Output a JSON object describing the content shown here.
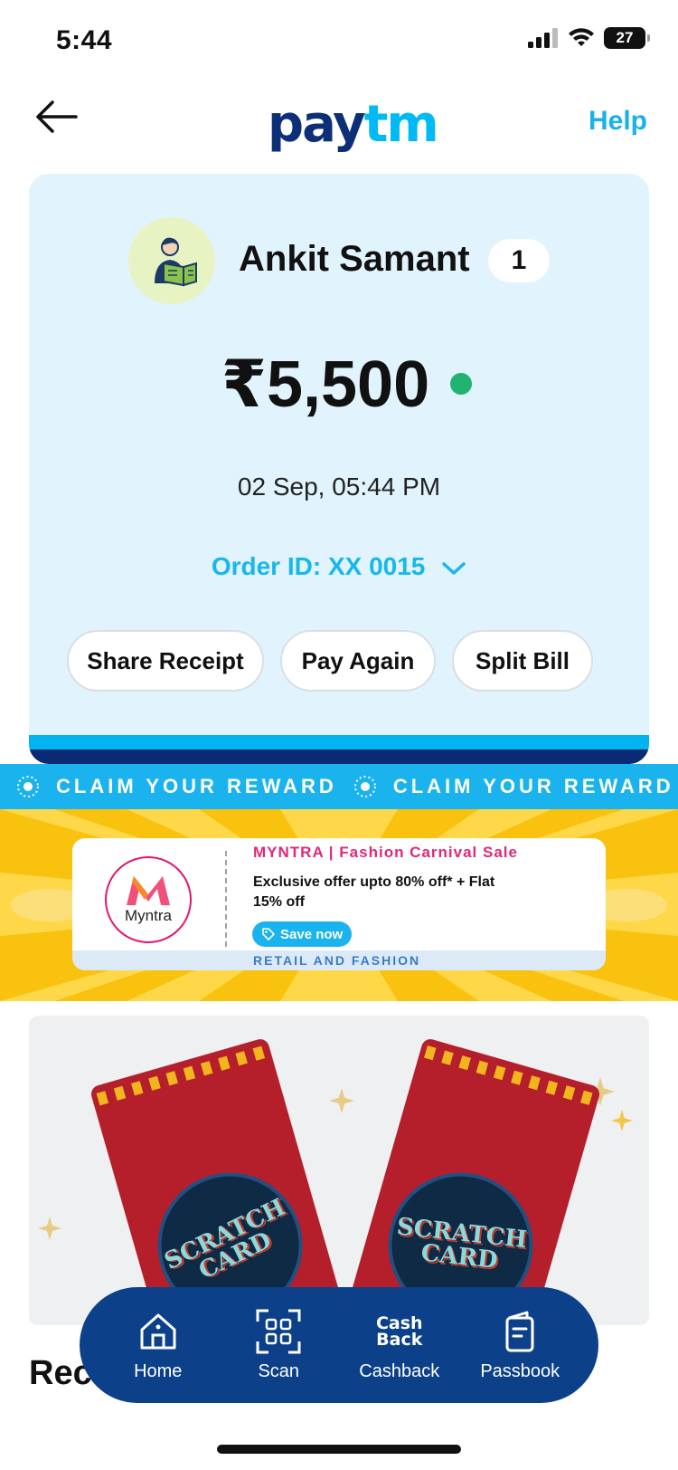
{
  "status_bar": {
    "time": "5:44",
    "battery": "27"
  },
  "header": {
    "logo_pay": "pay",
    "logo_tm": "tm",
    "help": "Help"
  },
  "receipt": {
    "payee_name": "Ankit Samant",
    "badge_count": "1",
    "amount": "₹5,500",
    "datetime": "02 Sep, 05:44 PM",
    "order_id": "Order ID: XX 0015",
    "actions": [
      "Share Receipt",
      "Pay Again",
      "Split Bill"
    ]
  },
  "reward_ribbon": {
    "text": "CLAIM YOUR REWARD"
  },
  "offer": {
    "brand": "Myntra",
    "title": "MYNTRA | Fashion Carnival Sale",
    "description": "Exclusive offer upto 80% off* + Flat 15% off",
    "cta": "Save now",
    "category": "RETAIL AND FASHION"
  },
  "scratch_cards": {
    "label_line1": "SCRATCH",
    "label_line2": "CARD"
  },
  "bottom_nav": {
    "items": [
      {
        "label": "Home",
        "icon": "home-icon"
      },
      {
        "label": "Scan",
        "icon": "scan-icon"
      },
      {
        "label": "Cashback",
        "icon": "cashback-icon",
        "icon_text_1": "Cash",
        "icon_text_2": "Back"
      },
      {
        "label": "Passbook",
        "icon": "passbook-icon"
      }
    ]
  },
  "recent": {
    "title_partial": "Rece"
  },
  "colors": {
    "accent": "#1ab3ed",
    "navy": "#0c418a",
    "card_bg": "#e1f3fc",
    "status_green": "#21b372",
    "banner_yellow": "#f9c20f",
    "brand_pink": "#e0287a"
  }
}
